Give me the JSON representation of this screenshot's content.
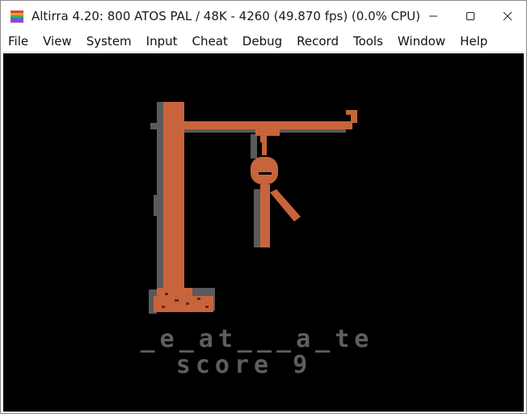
{
  "window": {
    "title": "Altirra 4.20: 800 ATOS PAL / 48K - 4260 (49.870 fps) (0.0% CPU)",
    "icon": "altirra-app-icon",
    "controls": [
      "minimize-icon",
      "maximize-icon",
      "close-icon"
    ]
  },
  "menu": {
    "items": [
      "File",
      "View",
      "System",
      "Input",
      "Cheat",
      "Debug",
      "Record",
      "Tools",
      "Window",
      "Help"
    ]
  },
  "game": {
    "word": "_e_at___a_te",
    "score": "score 9",
    "colors": {
      "background": "#000000",
      "gallows": "#c8643c",
      "shadow": "#5a5a5a",
      "text": "#5e5e5e"
    }
  }
}
